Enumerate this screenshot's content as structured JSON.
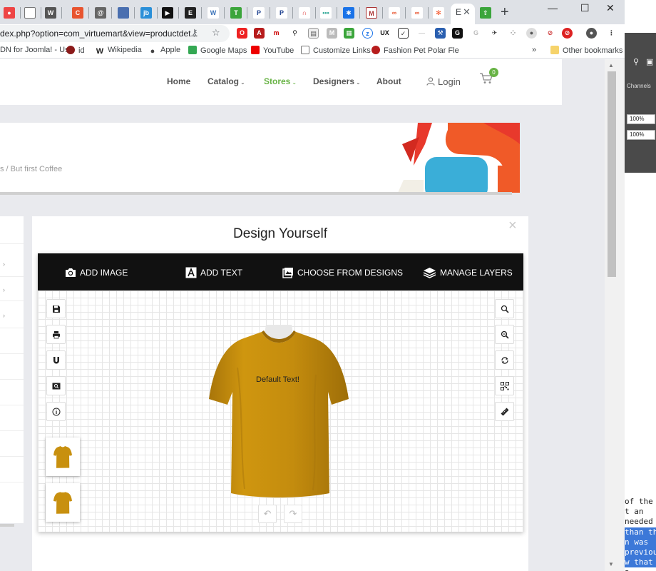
{
  "browser": {
    "url": "dex.php?option=com_virtuemart&view=productdet...",
    "active_tab_title": "E",
    "colors": {
      "tabstrip": "#dee1e6",
      "accent": "#68b345"
    },
    "bookmarks": [
      {
        "label": "DN for Joomla! - Us",
        "icon": "joomla-icon"
      },
      {
        "label": "id",
        "icon": "red-logo-icon"
      },
      {
        "label": "Wikipedia",
        "icon": "wikipedia-icon"
      },
      {
        "label": "Apple",
        "icon": "apple-icon"
      },
      {
        "label": "Google Maps",
        "icon": "google-maps-icon"
      },
      {
        "label": "YouTube",
        "icon": "youtube-icon"
      },
      {
        "label": "Customize Links",
        "icon": "page-icon"
      },
      {
        "label": "Fashion Pet Polar Fle",
        "icon": "pet-icon"
      }
    ],
    "bookmarks_overflow": "»",
    "other_bookmarks": "Other bookmarks",
    "new_tab_symbol": "+",
    "window_controls": [
      "—",
      "☐",
      "✕"
    ]
  },
  "site": {
    "nav": [
      {
        "label": "Home",
        "dropdown": false
      },
      {
        "label": "Catalog",
        "dropdown": true
      },
      {
        "label": "Stores",
        "dropdown": true,
        "active": true
      },
      {
        "label": "Designers",
        "dropdown": true
      },
      {
        "label": "About",
        "dropdown": false
      }
    ],
    "login_label": "Login",
    "cart_count": "0",
    "breadcrumb": "s /   But first Coffee"
  },
  "designer": {
    "title": "Design Yourself",
    "close_symbol": "×",
    "toolbar": [
      {
        "label": "ADD IMAGE",
        "icon": "camera-icon"
      },
      {
        "label": "ADD TEXT",
        "icon": "text-icon"
      },
      {
        "label": "CHOOSE FROM DESIGNS",
        "icon": "gallery-icon"
      },
      {
        "label": "MANAGE LAYERS",
        "icon": "layers-icon"
      }
    ],
    "left_tools": [
      "save-icon",
      "print-icon",
      "magnet-icon",
      "preview-icon",
      "info-icon"
    ],
    "right_tools": [
      "zoom-in-icon",
      "zoom-out-icon",
      "rotate-icon",
      "qr-code-icon",
      "ruler-icon"
    ],
    "canvas_text": "Default Text!",
    "shirt_color": "#c8900f",
    "view_thumbnails": [
      "front-view",
      "back-view"
    ],
    "undo_symbol": "↶",
    "redo_symbol": "↷"
  },
  "side_app": {
    "panel_title": "Channels",
    "zoom_values": [
      "100%",
      "100%"
    ],
    "code_lines": [
      "of the",
      "t an",
      "needed",
      "than th",
      "n was",
      "previou",
      "w that",
      "a"
    ]
  }
}
